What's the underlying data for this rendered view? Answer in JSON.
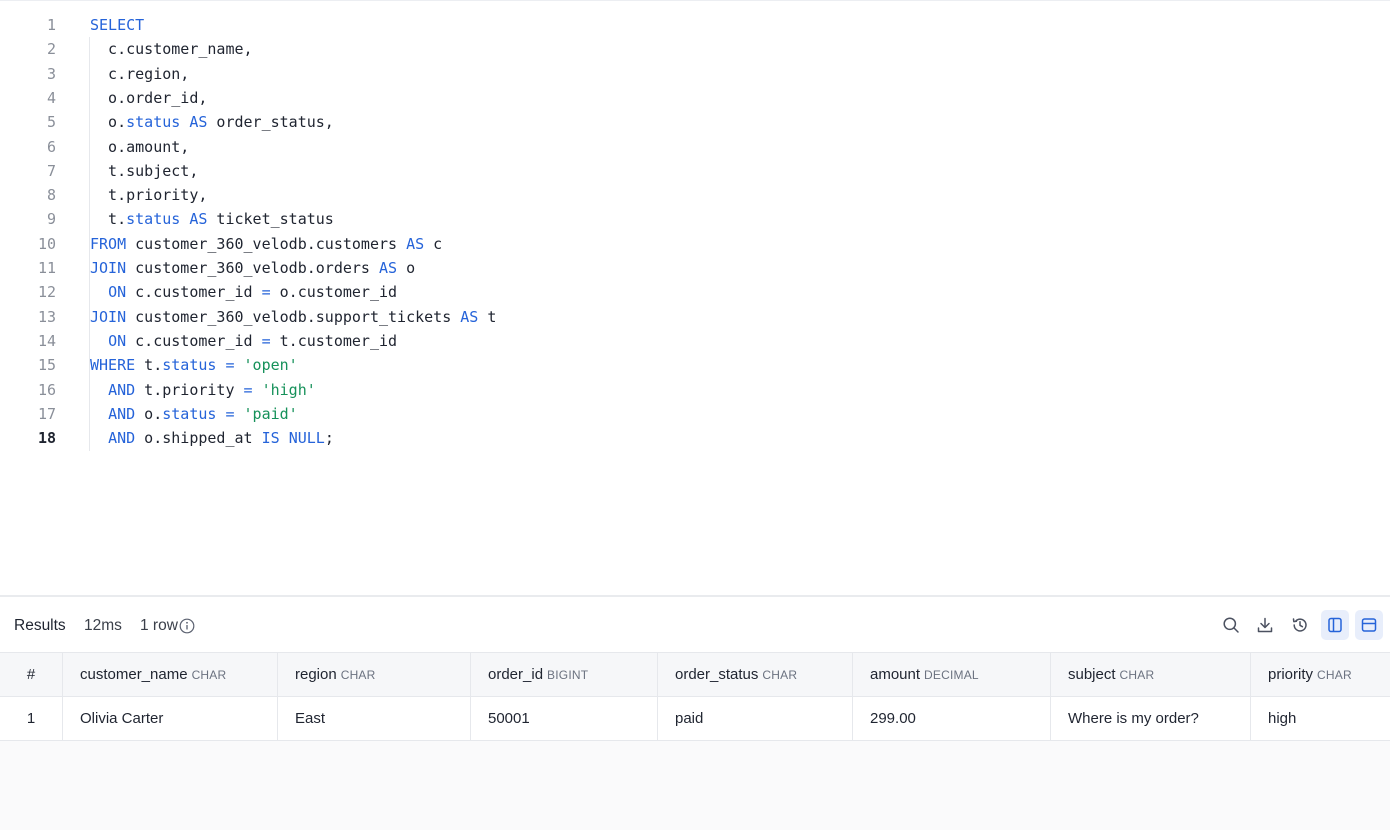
{
  "editor": {
    "active_line": 18,
    "lines": [
      {
        "n": "1",
        "html": "<span class=\"kw\">SELECT</span>"
      },
      {
        "n": "2",
        "html": "  c.customer_name,"
      },
      {
        "n": "3",
        "html": "  c.region,"
      },
      {
        "n": "4",
        "html": "  o.order_id,"
      },
      {
        "n": "5",
        "html": "  o.<span class=\"kw\">status</span> <span class=\"kw\">AS</span> order_status,"
      },
      {
        "n": "6",
        "html": "  o.amount,"
      },
      {
        "n": "7",
        "html": "  t.subject,"
      },
      {
        "n": "8",
        "html": "  t.priority,"
      },
      {
        "n": "9",
        "html": "  t.<span class=\"kw\">status</span> <span class=\"kw\">AS</span> ticket_status"
      },
      {
        "n": "10",
        "html": "<span class=\"kw\">FROM</span> customer_360_velodb.customers <span class=\"kw\">AS</span> c"
      },
      {
        "n": "11",
        "html": "<span class=\"kw\">JOIN</span> customer_360_velodb.orders <span class=\"kw\">AS</span> o"
      },
      {
        "n": "12",
        "html": "  <span class=\"kw\">ON</span> c.customer_id <span class=\"op\">=</span> o.customer_id"
      },
      {
        "n": "13",
        "html": "<span class=\"kw\">JOIN</span> customer_360_velodb.support_tickets <span class=\"kw\">AS</span> t"
      },
      {
        "n": "14",
        "html": "  <span class=\"kw\">ON</span> c.customer_id <span class=\"op\">=</span> t.customer_id"
      },
      {
        "n": "15",
        "html": "<span class=\"kw\">WHERE</span> t.<span class=\"kw\">status</span> <span class=\"op\">=</span> <span class=\"str\">'open'</span>"
      },
      {
        "n": "16",
        "html": "  <span class=\"kw\">AND</span> t.priority <span class=\"op\">=</span> <span class=\"str\">'high'</span>"
      },
      {
        "n": "17",
        "html": "  <span class=\"kw\">AND</span> o.<span class=\"kw\">status</span> <span class=\"op\">=</span> <span class=\"str\">'paid'</span>"
      },
      {
        "n": "18",
        "html": "  <span class=\"kw\">AND</span> o.shipped_at <span class=\"kw\">IS</span> <span class=\"kw\">NULL</span>;"
      }
    ]
  },
  "results": {
    "title": "Results",
    "time": "12ms",
    "row_count": "1 row",
    "toolbar": [
      "search-icon",
      "download-icon",
      "history-icon",
      "split-vertical-icon",
      "split-horizontal-icon"
    ],
    "columns": [
      {
        "name": "#",
        "type": ""
      },
      {
        "name": "customer_name",
        "type": "CHAR"
      },
      {
        "name": "region",
        "type": "CHAR"
      },
      {
        "name": "order_id",
        "type": "BIGINT"
      },
      {
        "name": "order_status",
        "type": "CHAR"
      },
      {
        "name": "amount",
        "type": "DECIMAL"
      },
      {
        "name": "subject",
        "type": "CHAR"
      },
      {
        "name": "priority",
        "type": "CHAR"
      }
    ],
    "rows": [
      [
        "1",
        "Olivia Carter",
        "East",
        "50001",
        "paid",
        "299.00",
        "Where is my order?",
        "high"
      ]
    ]
  },
  "colors": {
    "keyword": "#2563d9",
    "string": "#16915a",
    "selected_tool_bg": "#e8eefb"
  }
}
